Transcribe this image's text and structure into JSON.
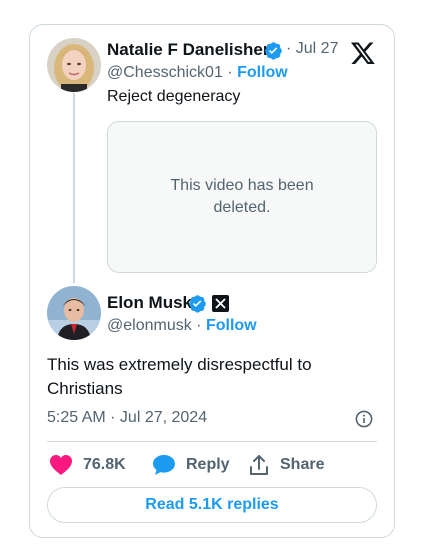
{
  "quoted_tweet": {
    "author_name": "Natalie F Danelishen",
    "date": "Jul 27",
    "handle": "@Chesschick01",
    "follow_label": "Follow",
    "text": "Reject degeneracy",
    "video_deleted_message": "This video has been deleted."
  },
  "main_tweet": {
    "author_name": "Elon Musk",
    "handle": "@elonmusk",
    "follow_label": "Follow",
    "text": "This was extremely disrespectful to Christians",
    "timestamp": "5:25 AM · Jul 27, 2024"
  },
  "actions": {
    "like_count": "76.8K",
    "reply_label": "Reply",
    "share_label": "Share"
  },
  "read_replies_label": "Read 5.1K replies",
  "separator": "·",
  "colors": {
    "accent": "#1d9bf0",
    "like": "#f91880",
    "verified": "#1d9bf0",
    "muted": "#536471",
    "border": "#cfd9de"
  },
  "icons": [
    "x-logo-icon",
    "verified-badge-icon",
    "heart-icon",
    "reply-icon",
    "share-icon",
    "info-icon"
  ]
}
